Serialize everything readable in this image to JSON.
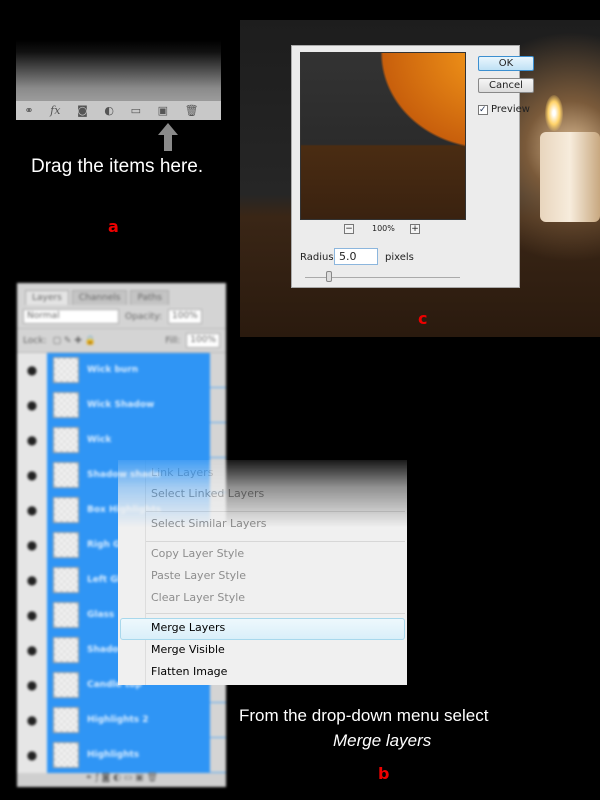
{
  "panel_a": {
    "icons": [
      "link-icon",
      "fx-icon",
      "mask-icon",
      "adjustment-icon",
      "folder-icon",
      "new-layer-icon",
      "trash-icon"
    ],
    "fx_label": "fx",
    "caption": "Drag the items here.",
    "label": "a"
  },
  "panel_c": {
    "ok": "OK",
    "cancel": "Cancel",
    "preview_label": "Preview",
    "preview_checked": true,
    "zoom": "100%",
    "zoom_out": "−",
    "zoom_in": "+",
    "radius_label": "Radius:",
    "radius_value": "5.0",
    "radius_unit": "pixels",
    "label": "c"
  },
  "panel_b": {
    "tabs": [
      "Layers",
      "Channels",
      "Paths"
    ],
    "blend_mode": "Normal",
    "opacity_label": "Opacity:",
    "opacity": "100%",
    "lock_label": "Lock:",
    "fill_label": "Fill:",
    "fill": "100%",
    "layers": [
      "Wick burn",
      "Wick Shadow",
      "Wick",
      "Shadow shade",
      "Box Highlights",
      "Righ Glass",
      "Left Glass",
      "Glass",
      "Shadow",
      "Candle top",
      "Highlights 2",
      "Highlights"
    ],
    "menu": {
      "items": [
        {
          "label": "Link Layers",
          "enabled": false
        },
        {
          "label": "Select Linked Layers",
          "enabled": false
        },
        {
          "label": "Select Similar Layers",
          "enabled": false
        },
        {
          "label": "Copy Layer Style",
          "enabled": false
        },
        {
          "label": "Paste Layer Style",
          "enabled": false
        },
        {
          "label": "Clear Layer Style",
          "enabled": false
        },
        {
          "label": "Merge Layers",
          "enabled": true,
          "highlighted": true
        },
        {
          "label": "Merge Visible",
          "enabled": true
        },
        {
          "label": "Flatten Image",
          "enabled": true
        }
      ]
    },
    "caption_line1": "From the drop-down menu select",
    "caption_line2": "Merge layers",
    "label": "b"
  },
  "colors": {
    "label_red": "#e00000",
    "selection_blue": "#2f95f5"
  }
}
